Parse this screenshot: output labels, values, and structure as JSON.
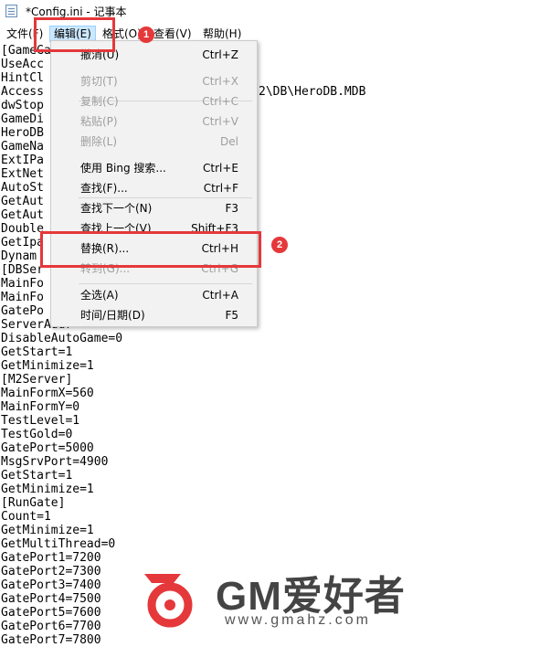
{
  "window": {
    "title": "*Config.ini - 记事本"
  },
  "menubar": [
    {
      "label": "文件(F)"
    },
    {
      "label": "编辑(E)"
    },
    {
      "label": "格式(O)"
    },
    {
      "label": "查看(V)"
    },
    {
      "label": "帮助(H)"
    }
  ],
  "edit_menu": [
    {
      "label": "撤消(U)",
      "shortcut": "Ctrl+Z",
      "enabled": true
    },
    {
      "label": "剪切(T)",
      "shortcut": "Ctrl+X",
      "enabled": false
    },
    {
      "label": "复制(C)",
      "shortcut": "Ctrl+C",
      "enabled": false
    },
    {
      "label": "粘贴(P)",
      "shortcut": "Ctrl+V",
      "enabled": false
    },
    {
      "label": "删除(L)",
      "shortcut": "Del",
      "enabled": false
    },
    {
      "label": "使用 Bing 搜索...",
      "shortcut": "Ctrl+E",
      "enabled": true
    },
    {
      "label": "查找(F)...",
      "shortcut": "Ctrl+F",
      "enabled": true
    },
    {
      "label": "查找下一个(N)",
      "shortcut": "F3",
      "enabled": true
    },
    {
      "label": "查找上一个(V)",
      "shortcut": "Shift+F3",
      "enabled": true
    },
    {
      "label": "替换(R)...",
      "shortcut": "Ctrl+H",
      "enabled": true
    },
    {
      "label": "转到(G)...",
      "shortcut": "Ctrl+G",
      "enabled": false
    },
    {
      "label": "全选(A)",
      "shortcut": "Ctrl+A",
      "enabled": true
    },
    {
      "label": "时间/日期(D)",
      "shortcut": "F5",
      "enabled": true
    }
  ],
  "editor_lines": [
    "[GameGate]",
    "UseAcc",
    "HintCl",
    "Access",
    "dwStop",
    "GameDi",
    "HeroDB",
    "GameNa",
    "ExtIPa",
    "ExtNet",
    "AutoSt",
    "GetAut",
    "GetAut",
    "Double",
    "GetIpa",
    "Dynam",
    "[DBSer",
    "MainFo",
    "MainFo",
    "GatePo",
    "ServerAddr=",
    "DisableAutoGame=0",
    "GetStart=1",
    "GetMinimize=1",
    "[M2Server]",
    "MainFormX=560",
    "MainFormY=0",
    "TestLevel=1",
    "TestGold=0",
    "GatePort=5000",
    "MsgSrvPort=4900",
    "GetStart=1",
    "GetMinimize=1",
    "[RunGate]",
    "Count=1",
    "GetMinimize=1",
    "GetMultiThread=0",
    "GatePort1=7200",
    "GatePort2=7300",
    "GatePort3=7400",
    "GatePort4=7500",
    "GatePort5=7600",
    "GatePort6=7700",
    "GatePort7=7800"
  ],
  "editor_fragment": "2\\DB\\HeroDB.MDB",
  "annotations": [
    {
      "label": "1"
    },
    {
      "label": "2"
    }
  ],
  "watermark": {
    "brand": "GM爱好者",
    "url": "www.gmahz.com"
  },
  "colors": {
    "highlight": "#e5383b",
    "menu_bg": "#f2f2f2",
    "active_menu": "#cce8ff"
  }
}
